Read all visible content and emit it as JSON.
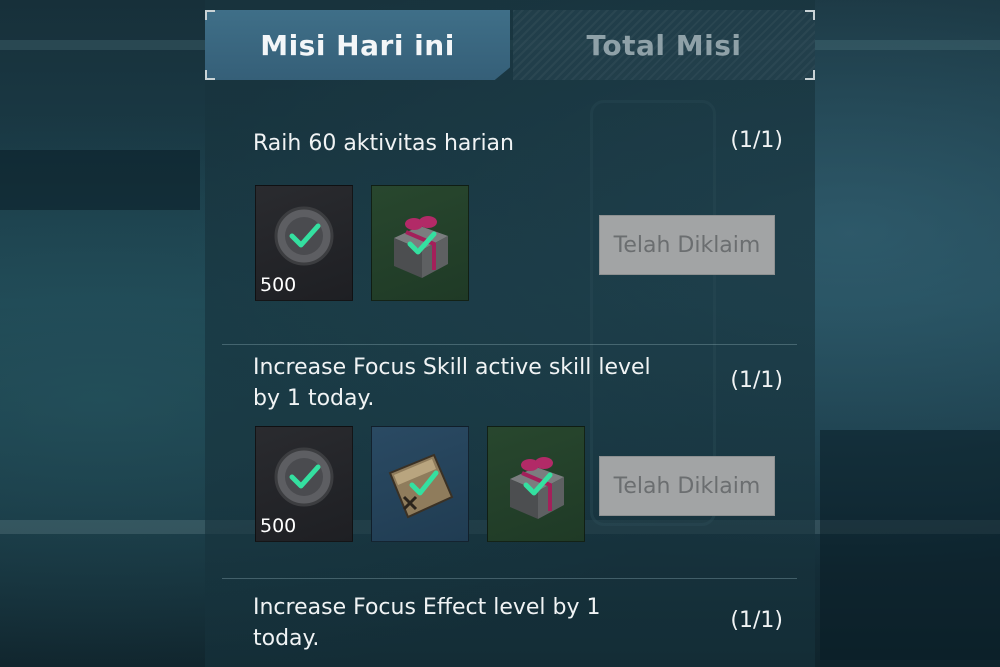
{
  "tabs": [
    {
      "label": "Misi Hari ini",
      "active": true
    },
    {
      "label": "Total Misi",
      "active": false
    }
  ],
  "missions": [
    {
      "title": "Raih 60 aktivitas harian",
      "progress": "(1/1)",
      "rewards": [
        {
          "icon": "coin-icon",
          "quantity": "500",
          "claimed": true
        },
        {
          "icon": "gift-box-icon",
          "quantity": "",
          "claimed": true
        }
      ],
      "button_label": "Telah Diklaim"
    },
    {
      "title": "Increase Focus Skill active skill level by 1 today.",
      "progress": "(1/1)",
      "rewards": [
        {
          "icon": "coin-icon",
          "quantity": "500",
          "claimed": true
        },
        {
          "icon": "manual-book-icon",
          "quantity": "",
          "claimed": true
        },
        {
          "icon": "gift-box-icon",
          "quantity": "",
          "claimed": true
        }
      ],
      "button_label": "Telah Diklaim"
    },
    {
      "title": "Increase Focus Effect level by 1 today.",
      "progress": "(1/1)"
    }
  ],
  "colors": {
    "active_tab": "#3f6f88",
    "claimed_button": "#a2a4a5",
    "check": "#34e0a0"
  }
}
